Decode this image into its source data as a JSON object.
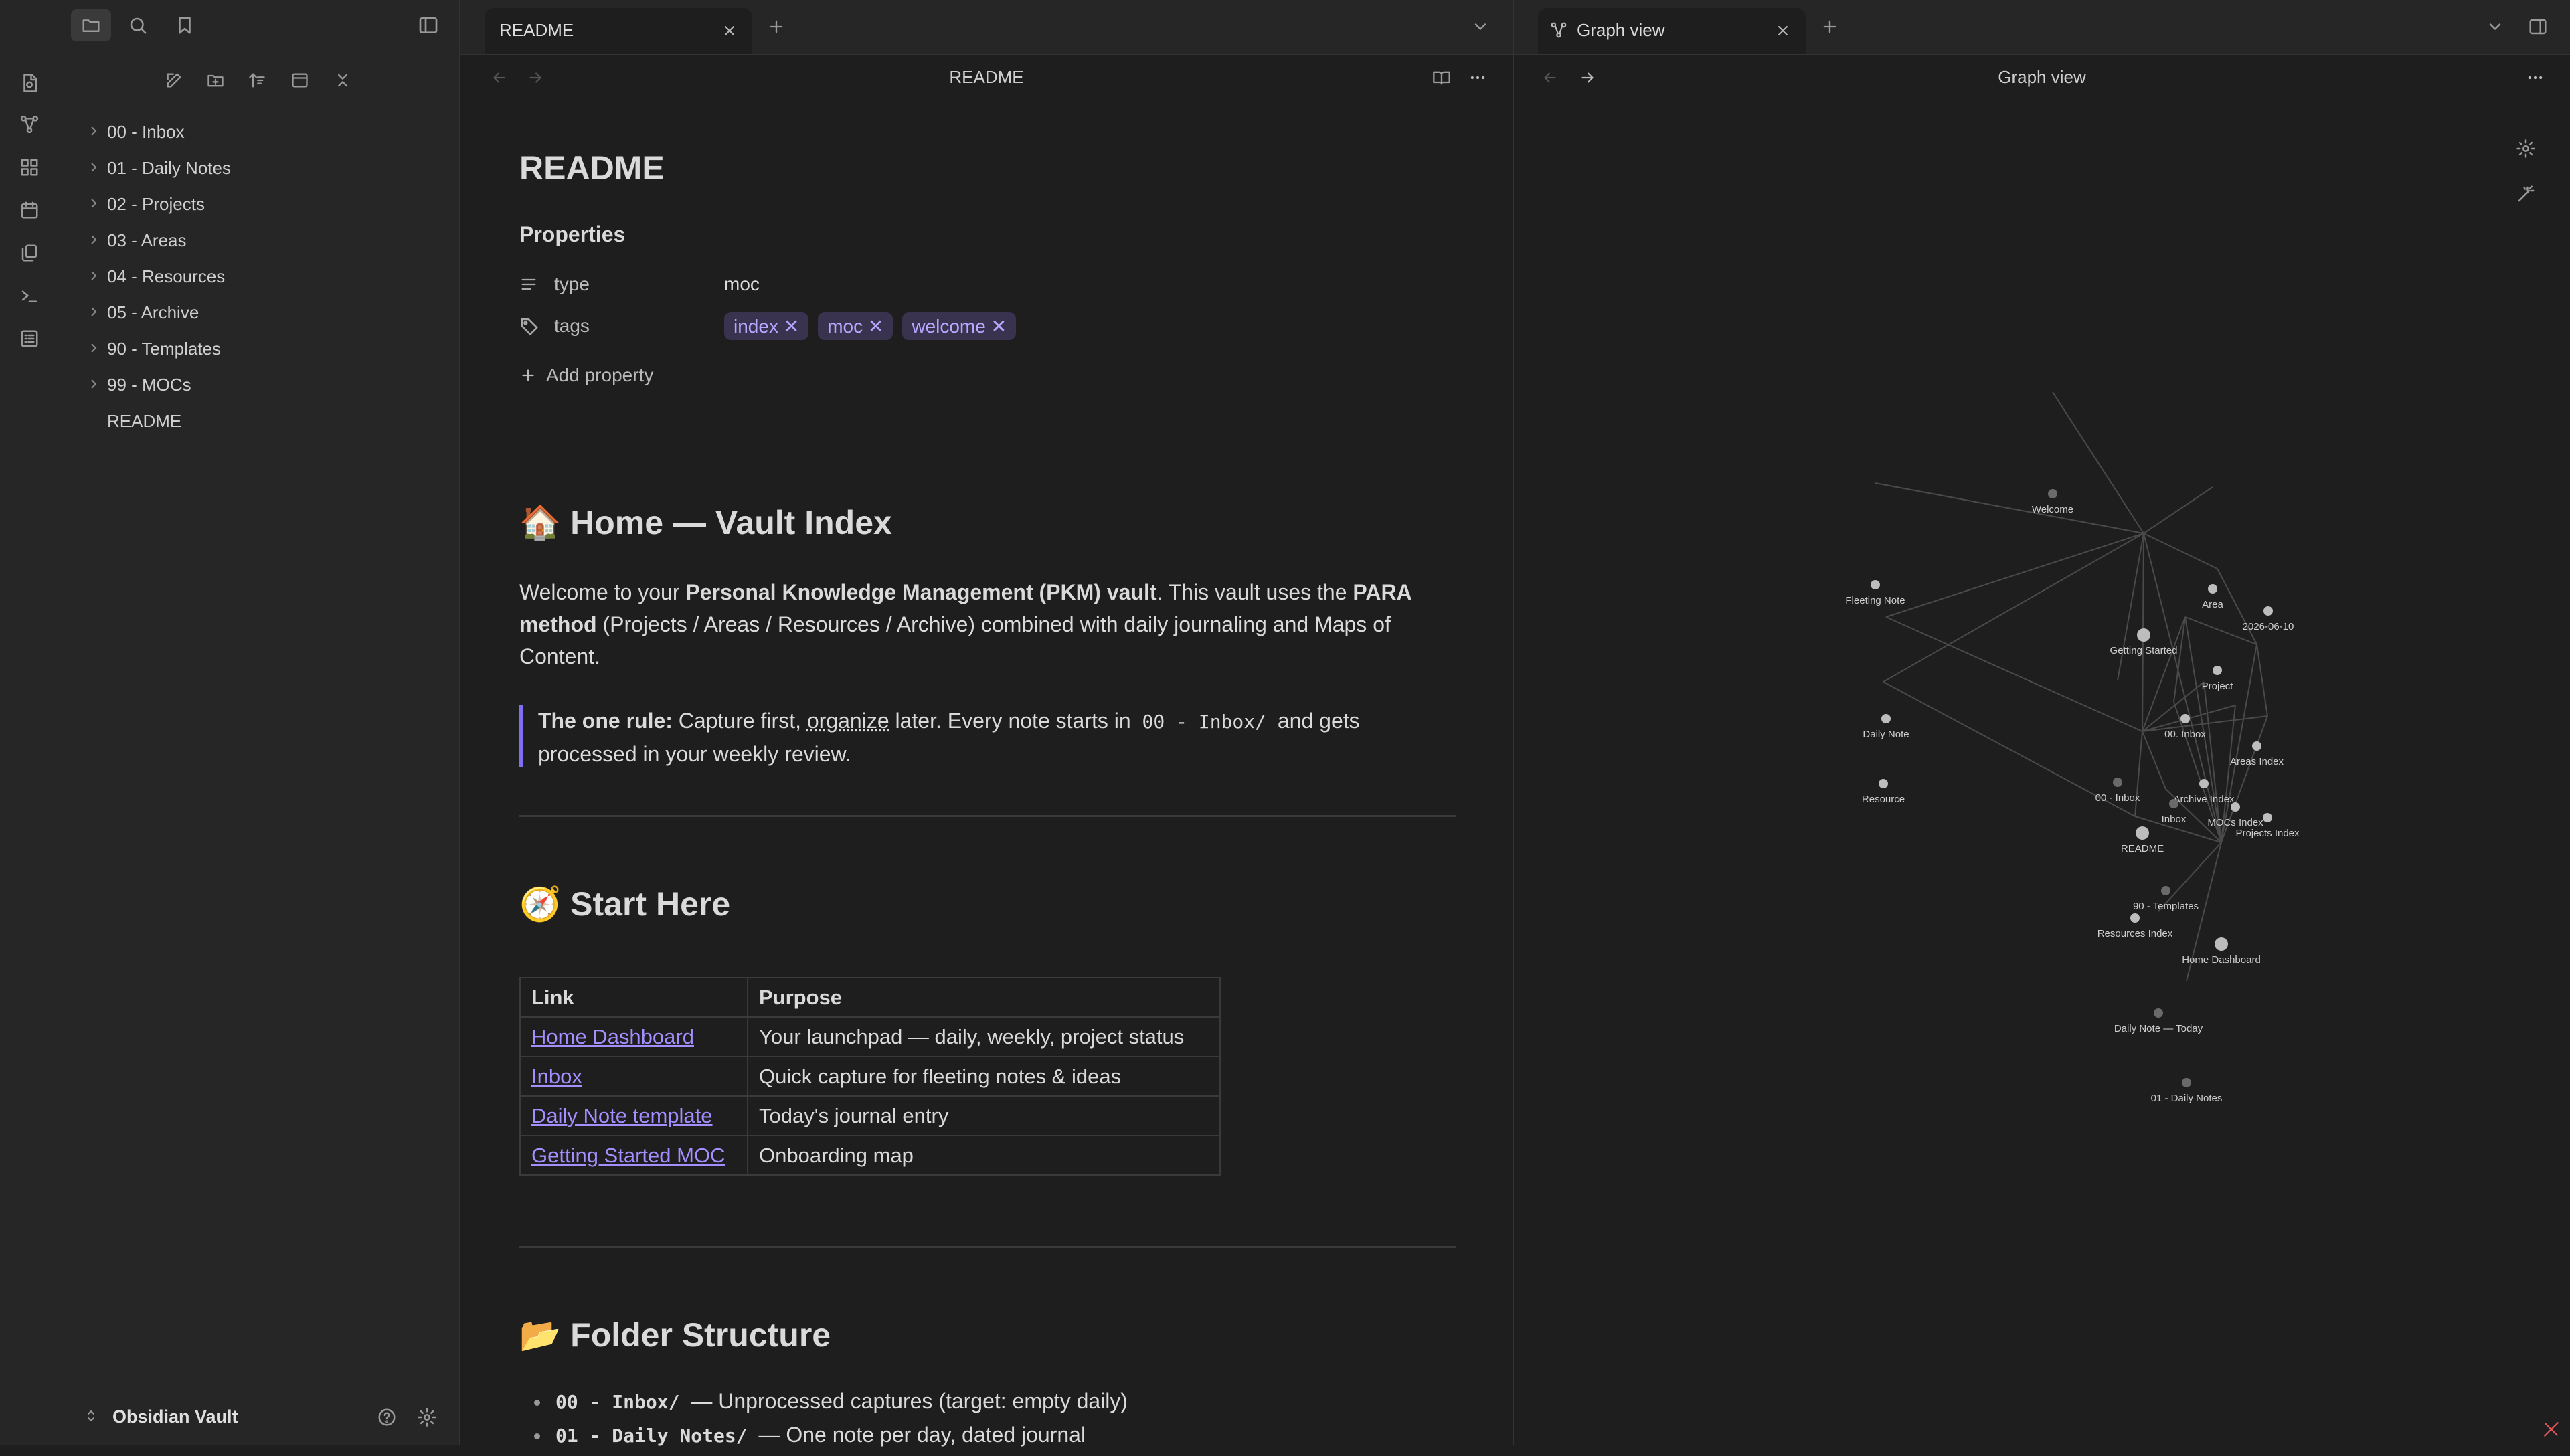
{
  "sidebar": {
    "items": [
      {
        "label": "00 - Inbox"
      },
      {
        "label": "01 - Daily Notes"
      },
      {
        "label": "02 - Projects"
      },
      {
        "label": "03 - Areas"
      },
      {
        "label": "04 - Resources"
      },
      {
        "label": "05 - Archive"
      },
      {
        "label": "90 - Templates"
      },
      {
        "label": "99 - MOCs"
      }
    ],
    "file": "README",
    "vault_name": "Obsidian Vault"
  },
  "left_pane": {
    "tab_title": "README",
    "header_title": "README",
    "doc_title": "README",
    "properties_heading": "Properties",
    "props": {
      "type_label": "type",
      "type_value": "moc",
      "tags_label": "tags",
      "tags": [
        "index",
        "moc",
        "welcome"
      ],
      "add_property": "Add property"
    },
    "h_home": "🏠 Home — Vault Index",
    "welcome": {
      "p1": "Welcome to your ",
      "b1": "Personal Knowledge Management (PKM) vault",
      "p2": ". This vault uses the ",
      "b2": "PARA method",
      "p3": " (Projects / Areas / Resources / Archive) combined with daily journaling and Maps of Content."
    },
    "callout": {
      "bold": "The one rule:",
      "t1": " Capture first, ",
      "u": "organize",
      "t2": " later. Every note starts in ",
      "code": "00 - Inbox/",
      "t3": " and gets processed in your weekly review."
    },
    "h_start": "🧭 Start Here",
    "table": {
      "headers": [
        "Link",
        "Purpose"
      ],
      "rows": [
        [
          "Home Dashboard",
          "Your launchpad — daily, weekly, project status"
        ],
        [
          "Inbox",
          "Quick capture for fleeting notes & ideas"
        ],
        [
          "Daily Note template",
          "Today's journal entry"
        ],
        [
          "Getting Started MOC",
          "Onboarding map"
        ]
      ]
    },
    "h_folder": "📂 Folder Structure",
    "bullets": [
      {
        "code": "00 - Inbox/",
        "text": " — Unprocessed captures (target: empty daily)"
      },
      {
        "code": "01 - Daily Notes/",
        "text": " — One note per day, dated journal"
      }
    ]
  },
  "right_pane": {
    "tab_title": "Graph view",
    "header_title": "Graph view",
    "graph": {
      "nodes": [
        {
          "id": "welcome",
          "label": "Welcome"
        },
        {
          "id": "fleeting",
          "label": "Fleeting Note"
        },
        {
          "id": "area",
          "label": "Area"
        },
        {
          "id": "date",
          "label": "2026-06-10"
        },
        {
          "id": "gs",
          "label": "Getting Started"
        },
        {
          "id": "project",
          "label": "Project"
        },
        {
          "id": "daily",
          "label": "Daily Note"
        },
        {
          "id": "inbox00",
          "label": "00. Inbox"
        },
        {
          "id": "areasidx",
          "label": "Areas Index"
        },
        {
          "id": "resource",
          "label": "Resource"
        },
        {
          "id": "inbox00b",
          "label": "00 - Inbox"
        },
        {
          "id": "archidx",
          "label": "Archive Index"
        },
        {
          "id": "inbox",
          "label": "Inbox"
        },
        {
          "id": "mocs",
          "label": "MOCs Index"
        },
        {
          "id": "projidx",
          "label": "Projects Index"
        },
        {
          "id": "readme",
          "label": "README"
        },
        {
          "id": "tmpl",
          "label": "90 - Templates"
        },
        {
          "id": "residx",
          "label": "Resources Index"
        },
        {
          "id": "home",
          "label": "Home Dashboard"
        },
        {
          "id": "today",
          "label": "Daily Note — Today"
        },
        {
          "id": "dn01",
          "label": "01 - Daily Notes"
        }
      ],
      "edges": [
        [
          "welcome",
          "gs"
        ],
        [
          "fleeting",
          "gs"
        ],
        [
          "area",
          "gs"
        ],
        [
          "gs",
          "project"
        ],
        [
          "project",
          "areasidx"
        ],
        [
          "gs",
          "daily"
        ],
        [
          "gs",
          "resource"
        ],
        [
          "gs",
          "readme"
        ],
        [
          "gs",
          "home"
        ],
        [
          "gs",
          "inbox00b"
        ],
        [
          "inbox00",
          "areasidx"
        ],
        [
          "inbox00",
          "inbox"
        ],
        [
          "inbox00",
          "home"
        ],
        [
          "readme",
          "inbox00"
        ],
        [
          "readme",
          "archidx"
        ],
        [
          "readme",
          "mocs"
        ],
        [
          "readme",
          "projidx"
        ],
        [
          "readme",
          "residx"
        ],
        [
          "archidx",
          "home"
        ],
        [
          "mocs",
          "home"
        ],
        [
          "projidx",
          "home"
        ],
        [
          "areasidx",
          "home"
        ],
        [
          "residx",
          "home"
        ],
        [
          "tmpl",
          "home"
        ],
        [
          "resource",
          "residx"
        ],
        [
          "home",
          "today"
        ],
        [
          "home",
          "dn01"
        ],
        [
          "readme",
          "tmpl"
        ],
        [
          "inbox",
          "home"
        ],
        [
          "areasidx",
          "projidx"
        ],
        [
          "daily",
          "readme"
        ]
      ]
    }
  }
}
